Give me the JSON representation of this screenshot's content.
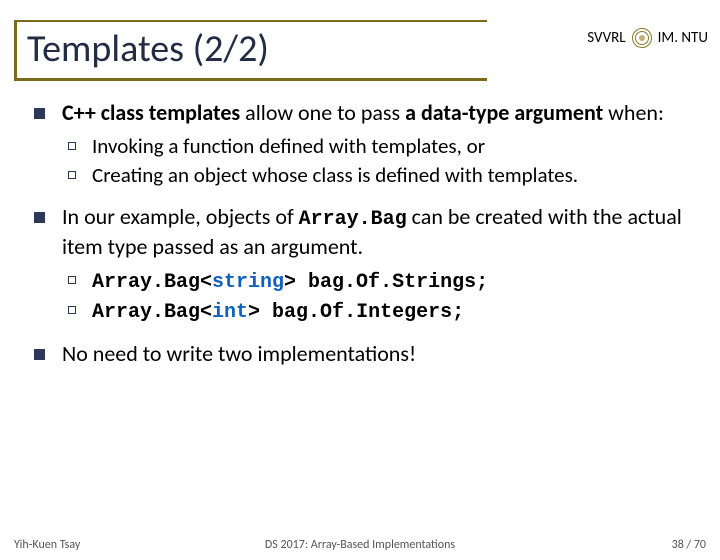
{
  "header": {
    "left": "SVVRL",
    "right": "IM. NTU"
  },
  "title": "Templates (2/2)",
  "bullets": [
    {
      "html": "<b>C++ class templates</b> allow one to pass <b>a data-type argument</b> when:",
      "sub": [
        {
          "text": "Invoking a function defined with templates, or"
        },
        {
          "text": "Creating an object whose class is defined with templates."
        }
      ]
    },
    {
      "html": "In our example, objects of <span class='mono'>Array.Bag</span> can be created with the actual item type passed as an argument.",
      "sub": [
        {
          "html": "<span class='mono'>Array.Bag&lt;<span class='kw'>string</span>&gt; bag.Of.Strings;</span>"
        },
        {
          "html": "<span class='mono'>Array.Bag&lt;<span class='kw'>int</span>&gt; bag.Of.Integers;</span>"
        }
      ]
    },
    {
      "html": "No need to write two implementations!"
    }
  ],
  "footer": {
    "left": "Yih-Kuen Tsay",
    "center": "DS 2017: Array-Based Implementations",
    "right": "38 / 70"
  }
}
